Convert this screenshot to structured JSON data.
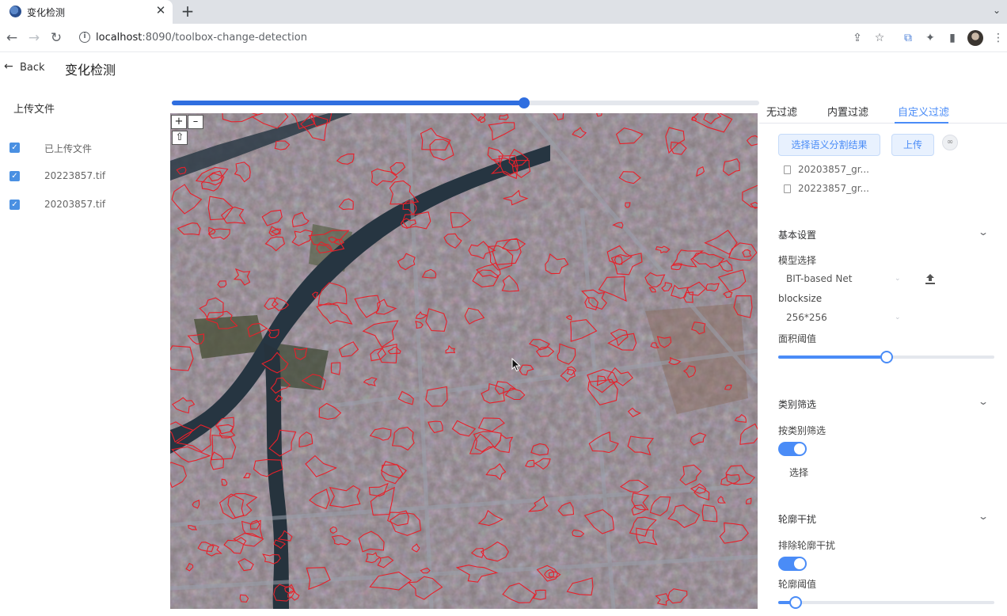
{
  "browser": {
    "tab_title": "变化检测",
    "url_host": "localhost",
    "url_rest": ":8090/toolbox-change-detection",
    "tab_close_glyph": "✕",
    "new_tab_glyph": "+"
  },
  "header": {
    "back_label": "Back",
    "title": "变化检测"
  },
  "sidebar": {
    "heading": "上传文件",
    "files": [
      {
        "label": "已上传文件",
        "checked": true
      },
      {
        "label": "20223857.tif",
        "checked": true
      },
      {
        "label": "20203857.tif",
        "checked": true
      }
    ]
  },
  "map": {
    "opacity_percent": 60,
    "zoom_in": "+",
    "zoom_out": "–",
    "reset": "⇧"
  },
  "filter_tabs": [
    {
      "label": "无过滤",
      "active": false
    },
    {
      "label": "内置过滤",
      "active": false
    },
    {
      "label": "自定义过滤",
      "active": true
    }
  ],
  "custom_filter": {
    "select_seg_button": "选择语义分割结果",
    "upload_button": "上传",
    "seg_files": [
      "20203857_gr...",
      "20223857_gr..."
    ]
  },
  "basic_settings": {
    "title": "基本设置",
    "model_label": "模型选择",
    "model_value": "BIT-based Net",
    "blocksize_label": "blocksize",
    "blocksize_value": "256*256",
    "area_threshold_label": "面积阈值",
    "area_threshold_percent": 50
  },
  "class_filter": {
    "title": "类别筛选",
    "toggle_label": "按类别筛选",
    "toggle_on": true,
    "select_label": "选择"
  },
  "contour_filter": {
    "title": "轮廓干扰",
    "toggle_label": "排除轮廓干扰",
    "toggle_on": true,
    "threshold_label": "轮廓阈值",
    "threshold_percent": 8
  },
  "colors": {
    "accent": "#4a8cf7",
    "map_slider": "#2f6ee0",
    "change_outline": "#e8202a"
  }
}
